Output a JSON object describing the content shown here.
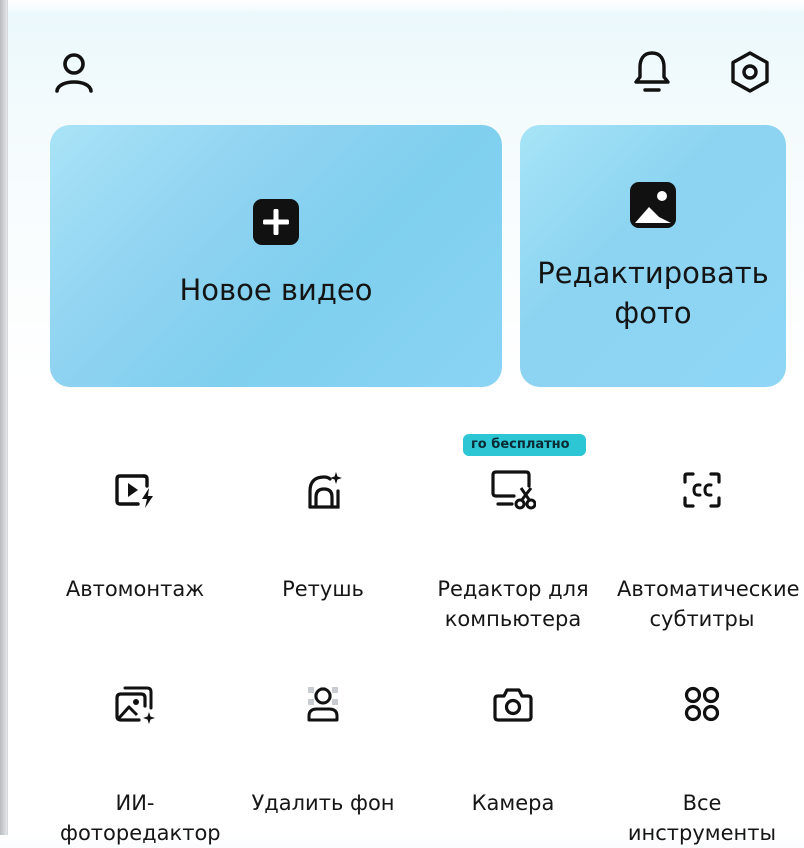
{
  "header": {
    "profile_icon": "profile-icon",
    "bell_icon": "bell-icon",
    "settings_icon": "settings-icon"
  },
  "cards": {
    "new_video": {
      "label": "Новое видео",
      "icon": "plus-square-icon"
    },
    "edit_photo": {
      "label": "Редактировать фото",
      "icon": "image-icon"
    }
  },
  "tools": [
    {
      "label": "Автомонтаж",
      "icon": "auto-edit-icon"
    },
    {
      "label": "Ретушь",
      "icon": "retouch-icon"
    },
    {
      "label": "Редактор для компьютера",
      "icon": "desktop-editor-icon",
      "badge": "го бесплатно"
    },
    {
      "label": "Автоматические субтитры",
      "icon": "captions-icon"
    },
    {
      "label": "ИИ-фоторедактор",
      "icon": "ai-photo-icon"
    },
    {
      "label": "Удалить фон",
      "icon": "remove-bg-icon"
    },
    {
      "label": "Камера",
      "icon": "camera-icon"
    },
    {
      "label": "Все инструменты",
      "icon": "all-tools-icon"
    }
  ],
  "colors": {
    "accent": "#2cc6d4",
    "card": "#8fd3f1",
    "icon": "#1a1a1a"
  }
}
